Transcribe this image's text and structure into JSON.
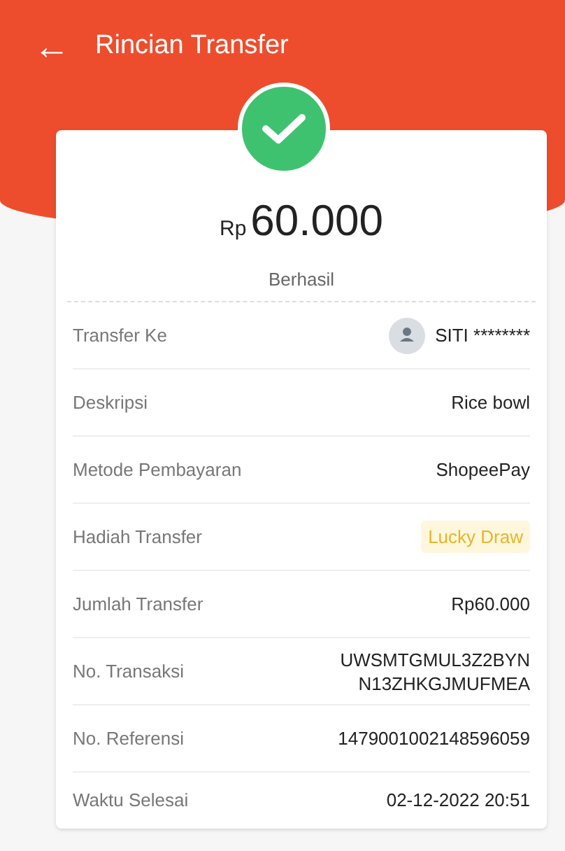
{
  "header": {
    "back": "←",
    "title": "Rincian Transfer"
  },
  "summary": {
    "currency": "Rp",
    "amount": "60.000",
    "status": "Berhasil"
  },
  "rows": [
    {
      "kind": "recipient",
      "label": "Transfer Ke",
      "value": "SITI ********"
    },
    {
      "kind": "text",
      "label": "Deskripsi",
      "value": "Rice bowl"
    },
    {
      "kind": "text",
      "label": "Metode Pembayaran",
      "value": "ShopeePay"
    },
    {
      "kind": "badge",
      "label": "Hadiah Transfer",
      "value": "Lucky Draw"
    },
    {
      "kind": "text",
      "label": "Jumlah Transfer",
      "value": "Rp60.000"
    },
    {
      "kind": "multiline",
      "label": "No. Transaksi",
      "value_lines": [
        "UWSMTGMUL3Z2BYN",
        "N13ZHKGJMUFMEA"
      ]
    },
    {
      "kind": "text",
      "label": "No. Referensi",
      "value": "1479001002148596059"
    },
    {
      "kind": "text",
      "label": "Waktu Selesai",
      "value": "02-12-2022 20:51"
    }
  ]
}
